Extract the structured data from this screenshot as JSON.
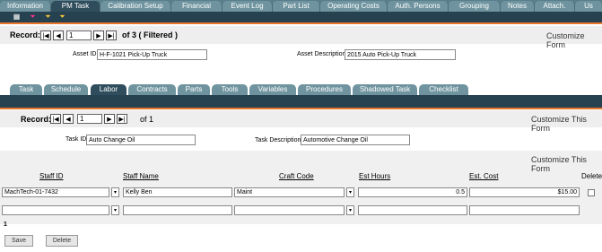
{
  "top_tabs": [
    {
      "label": "Information",
      "active": false
    },
    {
      "label": "PM Task",
      "active": true
    },
    {
      "label": "Calibration Setup",
      "active": false
    },
    {
      "label": "Financial",
      "active": false
    },
    {
      "label": "Event Log",
      "active": false
    },
    {
      "label": "Part List",
      "active": false
    },
    {
      "label": "Operating Costs",
      "active": false
    },
    {
      "label": "Auth. Persons",
      "active": false
    },
    {
      "label": "Grouping",
      "active": false
    },
    {
      "label": "Notes",
      "active": false
    },
    {
      "label": "Attach.",
      "active": false
    },
    {
      "label": "Us",
      "active": false
    }
  ],
  "record_bar": {
    "label": "Record:",
    "value": "1",
    "of_text": "of 3 ( Filtered )",
    "customize": "Customize Form"
  },
  "asset": {
    "id_label": "Asset ID",
    "id_value": "H-F-1021 Pick-Up Truck",
    "desc_label": "Asset Description",
    "desc_value": "2015 Auto Pick-Up Truck"
  },
  "sub_tabs": [
    {
      "label": "Task",
      "active": false
    },
    {
      "label": "Schedule",
      "active": false
    },
    {
      "label": "Labor",
      "active": true
    },
    {
      "label": "Contracts",
      "active": false
    },
    {
      "label": "Parts",
      "active": false
    },
    {
      "label": "Tools",
      "active": false
    },
    {
      "label": "Variables",
      "active": false
    },
    {
      "label": "Procedures",
      "active": false
    },
    {
      "label": "Shadowed Task",
      "active": false
    },
    {
      "label": "Checklist",
      "active": false
    }
  ],
  "record_bar2": {
    "label": "Record:",
    "value": "1",
    "of_text": "of 1",
    "customize": "Customize This Form"
  },
  "task": {
    "id_label": "Task ID",
    "id_value": "Auto Change Oil",
    "desc_label": "Task Description",
    "desc_value": "Automotive Change Oil"
  },
  "grid": {
    "customize": "Customize This Form",
    "headers": {
      "staff_id": "Staff ID",
      "staff_name": "Staff Name",
      "craft_code": "Craft Code",
      "est_hours": "Est Hours",
      "est_cost": "Est. Cost",
      "delete": "Delete"
    },
    "rows": [
      {
        "staff_id": "MachTech-01-7432",
        "staff_name": "Kelly Ben",
        "craft_code": "Maint",
        "est_hours": "0.5",
        "est_cost": "$15.00"
      },
      {
        "staff_id": "",
        "staff_name": "",
        "craft_code": "",
        "est_hours": "",
        "est_cost": ""
      }
    ],
    "count": "1"
  },
  "buttons": {
    "save": "Save",
    "delete": "Delete"
  }
}
